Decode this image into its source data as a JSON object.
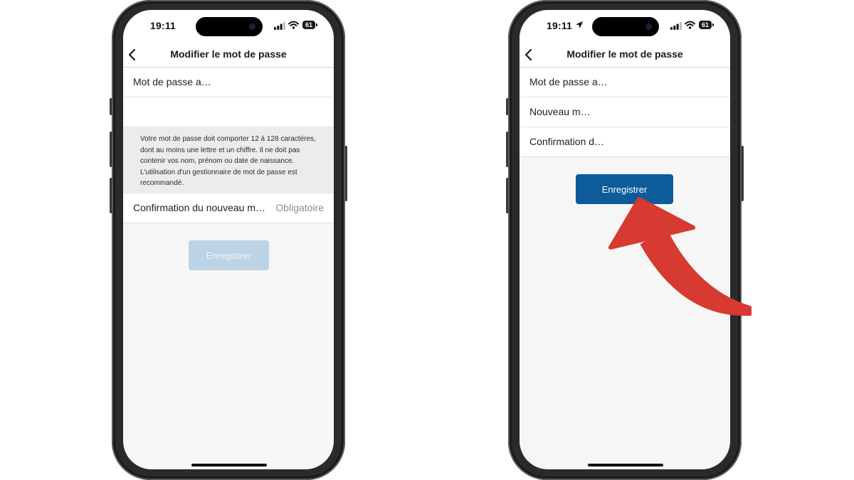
{
  "left_phone": {
    "status": {
      "time": "19:11",
      "battery": "61"
    },
    "nav": {
      "title": "Modifier le mot de passe"
    },
    "fields": {
      "current_password_label": "Mot de passe a…",
      "new_password_label": "",
      "confirm_label": "Confirmation du nouveau m…",
      "confirm_placeholder": "Obligatoire"
    },
    "hint": "Votre mot de passe doit comporter 12 à 128 caractères, dont au moins une lettre et un chiffre. Il ne doit pas contenir vos nom, prénom ou date de naissance. L'utilisation d'un gestionnaire de mot de passe est recommandé.",
    "save_button": {
      "label": "Enregistrer",
      "state": "disabled"
    }
  },
  "right_phone": {
    "status": {
      "time": "19:11",
      "battery": "61"
    },
    "nav": {
      "title": "Modifier le mot de passe"
    },
    "fields": {
      "current_password_label": "Mot de passe a…",
      "new_password_label": "Nouveau m…",
      "confirm_label": "Confirmation d…"
    },
    "save_button": {
      "label": "Enregistrer",
      "state": "enabled"
    }
  },
  "colors": {
    "accent": "#0d5b9b",
    "accent_disabled": "#bcd3e6",
    "annotation_arrow": "#d63a30"
  },
  "icons": [
    "back-chevron-icon",
    "signal-icon",
    "wifi-icon",
    "battery-icon",
    "location-arrow-icon",
    "annotation-arrow"
  ]
}
